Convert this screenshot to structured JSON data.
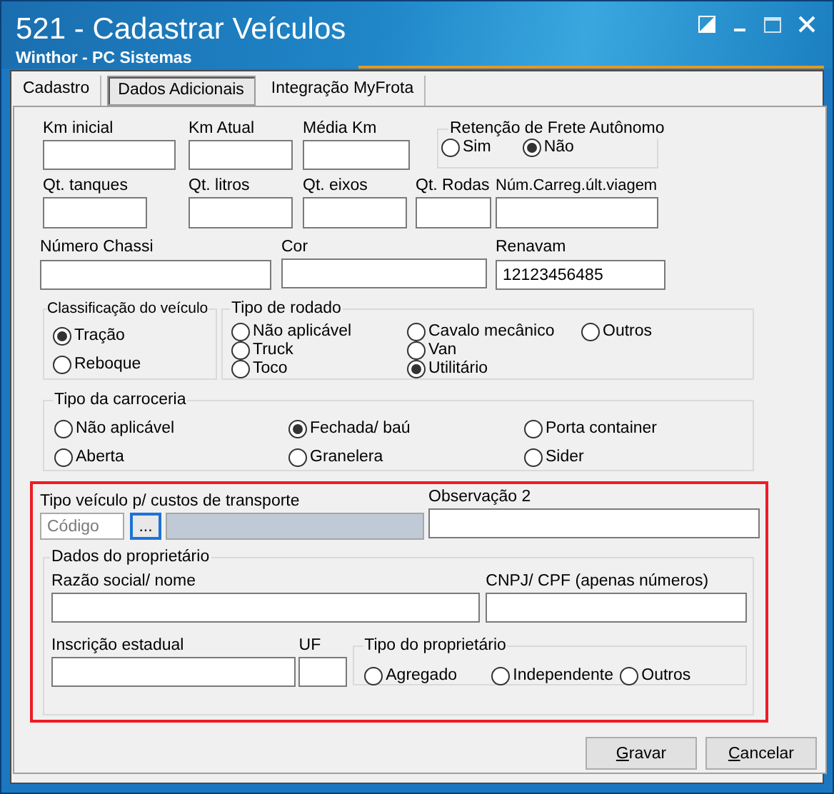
{
  "window": {
    "title": "521 - Cadastrar Veículos",
    "subtitle": "Winthor - PC Sistemas"
  },
  "tabs": [
    {
      "label": "Cadastro",
      "selected": false
    },
    {
      "label": "Dados Adicionais",
      "selected": true
    },
    {
      "label": "Integração MyFrota",
      "selected": false
    }
  ],
  "row_1": [
    {
      "label": "Km inicial"
    },
    {
      "label": "Km Atual"
    },
    {
      "label": "Média Km"
    }
  ],
  "retencao_frete": {
    "title": "Retenção de Frete Autônomo",
    "options": [
      {
        "label": "Sim",
        "selected": false
      },
      {
        "label": "Não",
        "selected": true
      }
    ]
  },
  "row_2": [
    {
      "label": "Qt. tanques"
    },
    {
      "label": "Qt. litros"
    },
    {
      "label": "Qt. eixos"
    },
    {
      "label": "Qt. Rodas"
    },
    {
      "label": "Núm.Carreg.últ.viagem"
    }
  ],
  "row_3": [
    {
      "label": "Número Chassi"
    },
    {
      "label": "Cor"
    },
    {
      "label": "Renavam",
      "value": "12123456485"
    }
  ],
  "classificacao": {
    "title": "Classificação do veículo",
    "options": [
      {
        "label": "Tração",
        "selected": true
      },
      {
        "label": "Reboque",
        "selected": false
      }
    ]
  },
  "tipo_rodado": {
    "title": "Tipo de rodado",
    "options": [
      {
        "label": "Não aplicável",
        "selected": false
      },
      {
        "label": "Truck",
        "selected": false
      },
      {
        "label": "Toco",
        "selected": false
      },
      {
        "label": "Cavalo mecânico",
        "selected": false
      },
      {
        "label": "Van",
        "selected": false
      },
      {
        "label": "Utilitário",
        "selected": true
      },
      {
        "label": "Outros",
        "selected": false
      }
    ]
  },
  "tipo_carroceria": {
    "title": "Tipo da carroceria",
    "options": [
      {
        "label": "Não aplicável",
        "selected": false
      },
      {
        "label": "Aberta",
        "selected": false
      },
      {
        "label": "Fechada/ baú",
        "selected": true
      },
      {
        "label": "Granelera",
        "selected": false
      },
      {
        "label": "Porta container",
        "selected": false
      },
      {
        "label": "Sider",
        "selected": false
      }
    ]
  },
  "custo_transporte": {
    "label": "Tipo veículo p/ custos de transporte",
    "placeholder": "Código",
    "lookup_button": "..."
  },
  "observacao": {
    "label": "Observação 2"
  },
  "proprietario": {
    "title": "Dados do proprietário",
    "razao_social": {
      "label": "Razão social/ nome"
    },
    "cnpj_cpf": {
      "label": "CNPJ/ CPF (apenas números)"
    },
    "inscricao": {
      "label": "Inscrição estadual"
    },
    "uf": {
      "label": "UF"
    },
    "tipo": {
      "title": "Tipo do proprietário",
      "options": [
        {
          "label": "Agregado",
          "selected": false
        },
        {
          "label": "Independente",
          "selected": false
        },
        {
          "label": "Outros",
          "selected": false
        }
      ]
    }
  },
  "buttons": [
    {
      "label": "Gravar"
    },
    {
      "label": "Cancelar"
    }
  ]
}
